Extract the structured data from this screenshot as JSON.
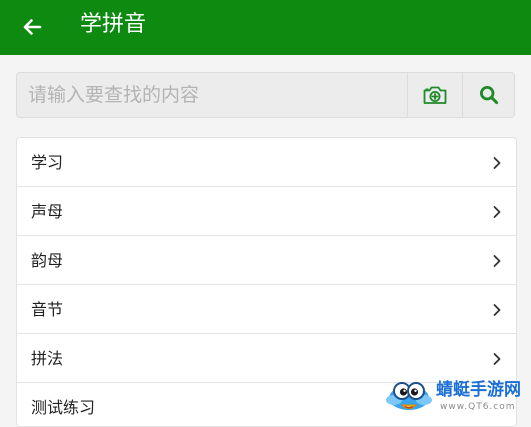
{
  "colors": {
    "brand": "#0d8a0f",
    "icon_accent": "#1e8a2a",
    "placeholder": "#b4b4b4",
    "watermark_text": "#1b6fd6"
  },
  "header": {
    "back_icon": "arrow-left-icon",
    "title": "学拼音"
  },
  "search": {
    "value": "",
    "placeholder": "请输入要查找的内容",
    "camera_icon": "camera-plus-icon",
    "search_icon": "search-icon"
  },
  "menu": {
    "chevron_icon": "chevron-right-icon",
    "items": [
      {
        "label": "学习"
      },
      {
        "label": "声母"
      },
      {
        "label": "韵母"
      },
      {
        "label": "音节"
      },
      {
        "label": "拼法"
      },
      {
        "label": "测试练习"
      }
    ]
  },
  "watermark": {
    "name": "蜻蜓手游网",
    "url": "www.QT6.com"
  }
}
